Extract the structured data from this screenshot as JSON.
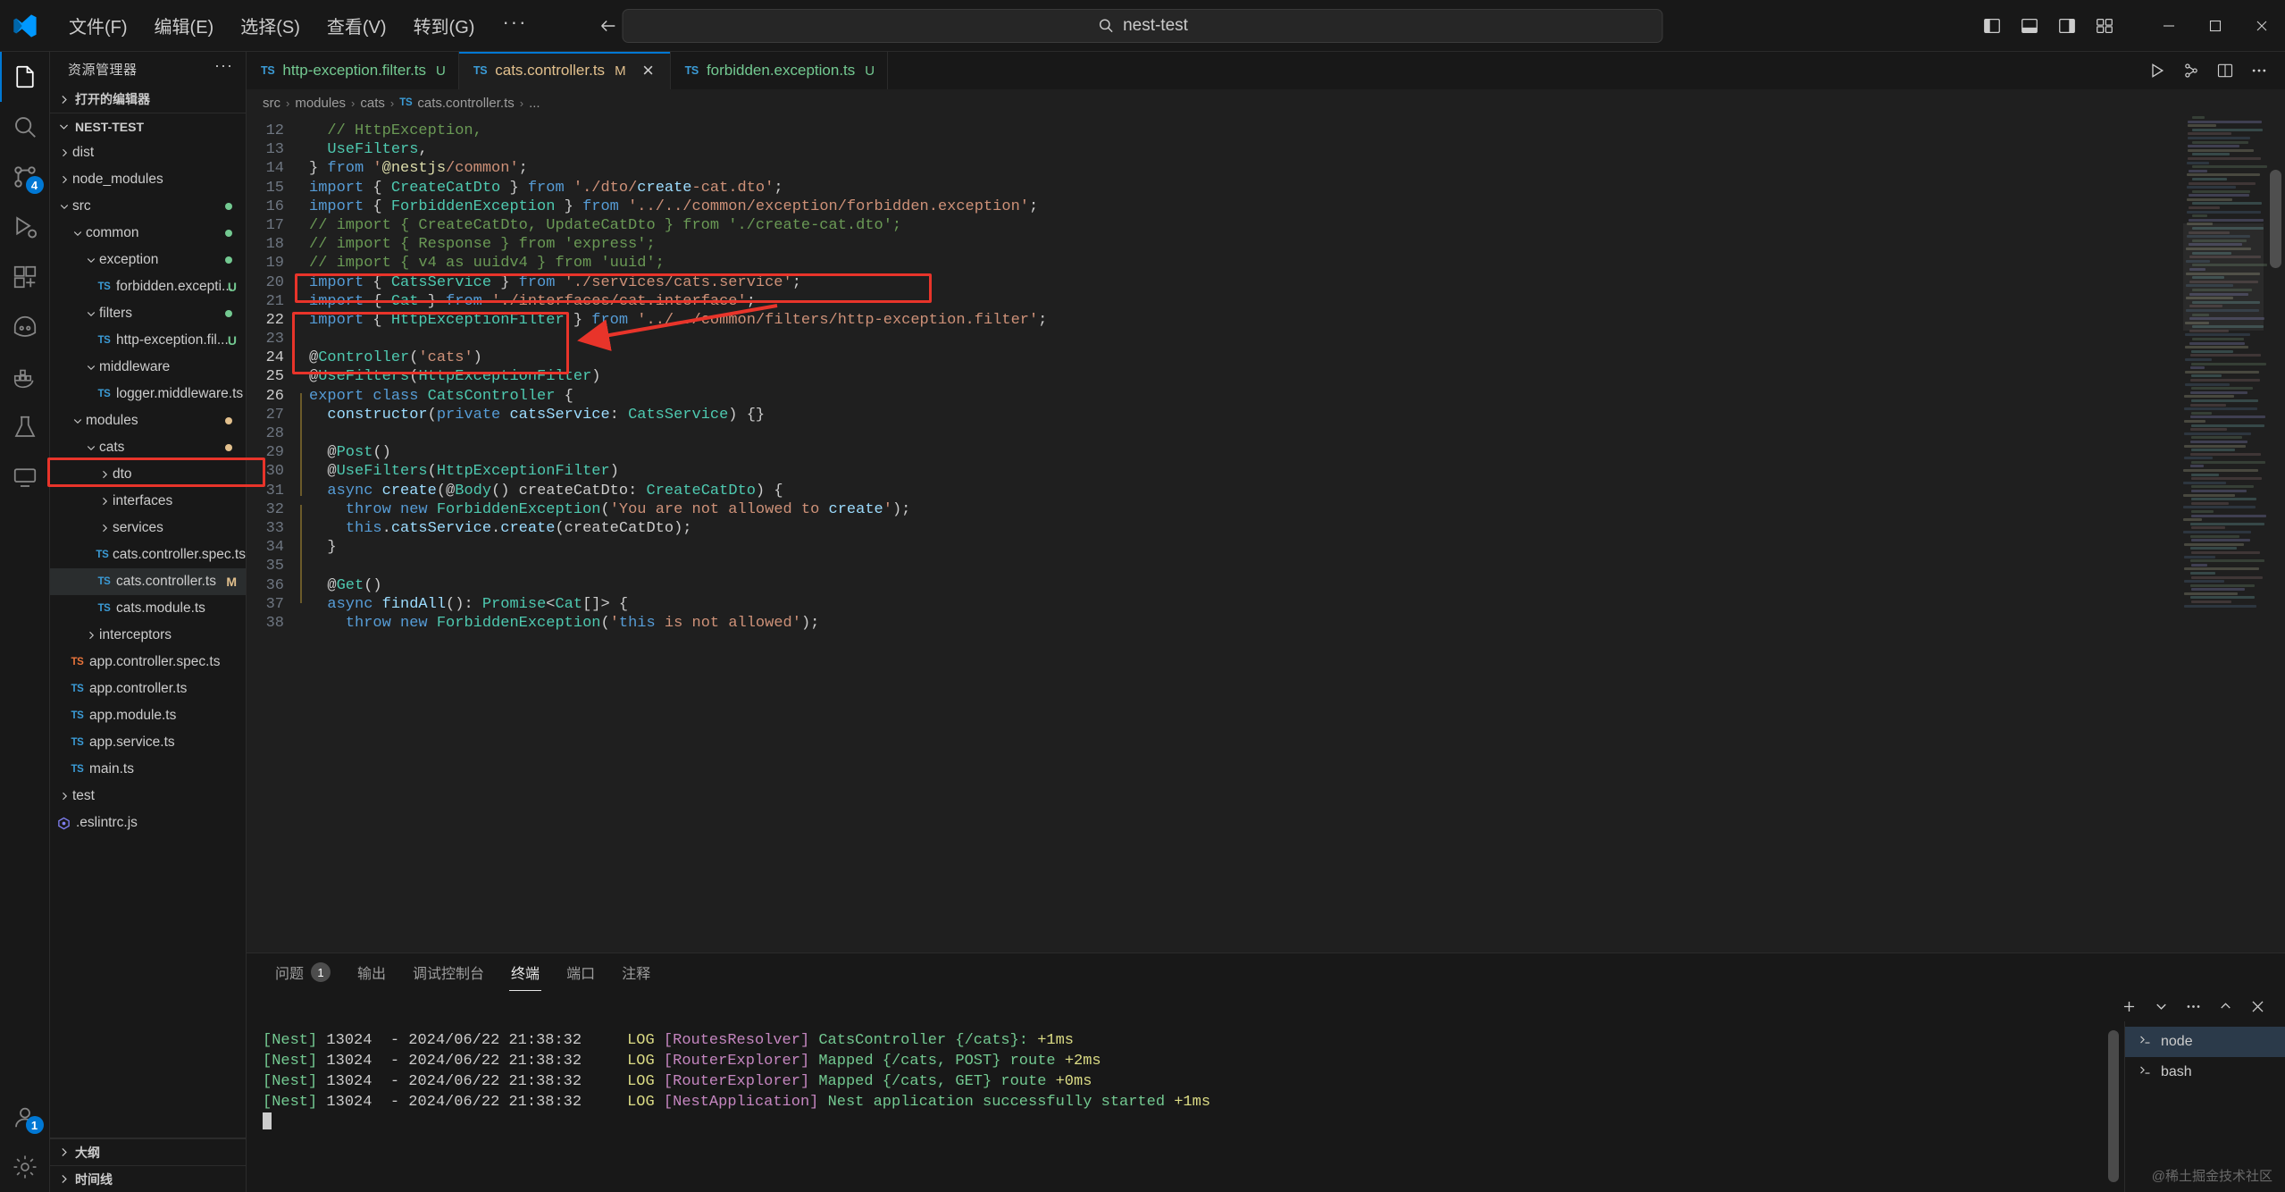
{
  "titlebar": {
    "menu": [
      "文件(F)",
      "编辑(E)",
      "选择(S)",
      "查看(V)",
      "转到(G)"
    ],
    "more": "···",
    "back_icon": "arrow-left-icon",
    "forward_icon": "arrow-right-icon",
    "search_text": "nest-test",
    "search_icon": "search-icon",
    "layout_icons": [
      "toggle-primary-sidebar-icon",
      "toggle-panel-icon",
      "toggle-secondary-sidebar-icon",
      "customize-layout-icon"
    ],
    "window_buttons": [
      "minimize",
      "maximize",
      "close"
    ]
  },
  "activitybar": {
    "items": [
      {
        "name": "explorer",
        "icon": "files-icon",
        "active": true,
        "badge": ""
      },
      {
        "name": "search",
        "icon": "search-icon",
        "active": false,
        "badge": ""
      },
      {
        "name": "source-control",
        "icon": "source-control-icon",
        "active": false,
        "badge": "4"
      },
      {
        "name": "run-debug",
        "icon": "debug-icon",
        "active": false,
        "badge": ""
      },
      {
        "name": "extensions",
        "icon": "extensions-icon",
        "active": false,
        "badge": ""
      },
      {
        "name": "copilot",
        "icon": "copilot-icon",
        "active": false,
        "badge": ""
      },
      {
        "name": "docker",
        "icon": "docker-icon",
        "active": false,
        "badge": ""
      },
      {
        "name": "testing",
        "icon": "beaker-icon",
        "active": false,
        "badge": ""
      },
      {
        "name": "remote-explorer",
        "icon": "remote-icon",
        "active": false,
        "badge": ""
      }
    ],
    "bottom": [
      {
        "name": "accounts",
        "icon": "account-icon",
        "badge": "1"
      },
      {
        "name": "settings",
        "icon": "gear-icon",
        "badge": ""
      }
    ]
  },
  "sidebar": {
    "title": "资源管理器",
    "dots": "···",
    "open_editors_label": "打开的编辑器",
    "project_name": "NEST-TEST",
    "outline_label": "大纲",
    "timeline_label": "时间线",
    "tree": [
      {
        "label": "dist",
        "depth": 1,
        "type": "folder",
        "open": false,
        "color": "dim",
        "badge": "",
        "dot": ""
      },
      {
        "label": "node_modules",
        "depth": 1,
        "type": "folder",
        "open": false,
        "color": "dim",
        "badge": "",
        "dot": ""
      },
      {
        "label": "src",
        "depth": 1,
        "type": "folder",
        "open": true,
        "color": "g",
        "badge": "",
        "dot": "#73c991"
      },
      {
        "label": "common",
        "depth": 2,
        "type": "folder",
        "open": true,
        "color": "g",
        "badge": "",
        "dot": "#73c991"
      },
      {
        "label": "exception",
        "depth": 3,
        "type": "folder",
        "open": true,
        "color": "g",
        "badge": "",
        "dot": "#73c991"
      },
      {
        "label": "forbidden.excepti...",
        "depth": 4,
        "type": "ts",
        "open": false,
        "color": "g",
        "badge": "U",
        "dot": ""
      },
      {
        "label": "filters",
        "depth": 3,
        "type": "folder",
        "open": true,
        "color": "g",
        "badge": "",
        "dot": "#73c991"
      },
      {
        "label": "http-exception.fil...",
        "depth": 4,
        "type": "ts",
        "open": false,
        "color": "g",
        "badge": "U",
        "dot": ""
      },
      {
        "label": "middleware",
        "depth": 3,
        "type": "folder",
        "open": true,
        "color": "",
        "badge": "",
        "dot": ""
      },
      {
        "label": "logger.middleware.ts",
        "depth": 4,
        "type": "ts",
        "open": false,
        "color": "",
        "badge": "",
        "dot": ""
      },
      {
        "label": "modules",
        "depth": 2,
        "type": "folder",
        "open": true,
        "color": "y",
        "badge": "",
        "dot": "#e2c08d"
      },
      {
        "label": "cats",
        "depth": 3,
        "type": "folder",
        "open": true,
        "color": "y",
        "badge": "",
        "dot": "#e2c08d"
      },
      {
        "label": "dto",
        "depth": 4,
        "type": "folder",
        "open": false,
        "color": "",
        "badge": "",
        "dot": ""
      },
      {
        "label": "interfaces",
        "depth": 4,
        "type": "folder",
        "open": false,
        "color": "",
        "badge": "",
        "dot": ""
      },
      {
        "label": "services",
        "depth": 4,
        "type": "folder",
        "open": false,
        "color": "",
        "badge": "",
        "dot": ""
      },
      {
        "label": "cats.controller.spec.ts",
        "depth": 4,
        "type": "ts",
        "open": false,
        "color": "",
        "badge": "",
        "dot": ""
      },
      {
        "label": "cats.controller.ts",
        "depth": 4,
        "type": "ts",
        "open": false,
        "color": "y",
        "badge": "M",
        "dot": "",
        "selected": true
      },
      {
        "label": "cats.module.ts",
        "depth": 4,
        "type": "ts",
        "open": false,
        "color": "",
        "badge": "",
        "dot": ""
      },
      {
        "label": "interceptors",
        "depth": 3,
        "type": "folder",
        "open": false,
        "color": "",
        "badge": "",
        "dot": ""
      },
      {
        "label": "app.controller.spec.ts",
        "depth": 2,
        "type": "ts-o",
        "open": false,
        "color": "",
        "badge": "",
        "dot": ""
      },
      {
        "label": "app.controller.ts",
        "depth": 2,
        "type": "ts",
        "open": false,
        "color": "",
        "badge": "",
        "dot": ""
      },
      {
        "label": "app.module.ts",
        "depth": 2,
        "type": "ts",
        "open": false,
        "color": "",
        "badge": "",
        "dot": ""
      },
      {
        "label": "app.service.ts",
        "depth": 2,
        "type": "ts",
        "open": false,
        "color": "",
        "badge": "",
        "dot": ""
      },
      {
        "label": "main.ts",
        "depth": 2,
        "type": "ts",
        "open": false,
        "color": "",
        "badge": "",
        "dot": ""
      },
      {
        "label": "test",
        "depth": 1,
        "type": "folder",
        "open": false,
        "color": "",
        "badge": "",
        "dot": ""
      },
      {
        "label": ".eslintrc.js",
        "depth": 1,
        "type": "eslint",
        "open": false,
        "color": "",
        "badge": "",
        "dot": ""
      }
    ]
  },
  "tabs": [
    {
      "name": "http-exception.filter.ts",
      "mark": "U",
      "mark_color": "#73c991",
      "name_color": "#73c991",
      "active": false,
      "closable": false
    },
    {
      "name": "cats.controller.ts",
      "mark": "M",
      "mark_color": "#e2c08d",
      "name_color": "#e2c08d",
      "active": true,
      "closable": true
    },
    {
      "name": "forbidden.exception.ts",
      "mark": "U",
      "mark_color": "#73c991",
      "name_color": "#73c991",
      "active": false,
      "closable": false
    }
  ],
  "tabs_actions": [
    "run-icon",
    "split-run-icon",
    "split-editor-icon",
    "more-actions-icon"
  ],
  "breadcrumb": [
    "src",
    "modules",
    "cats",
    "cats.controller.ts",
    "..."
  ],
  "editor": {
    "first_line": 12,
    "lines": [
      {
        "n": 12,
        "text": "  // HttpException,"
      },
      {
        "n": 13,
        "text": "  UseFilters,"
      },
      {
        "n": 14,
        "text": "} from '@nestjs/common';"
      },
      {
        "n": 15,
        "text": "import { CreateCatDto } from './dto/create-cat.dto';"
      },
      {
        "n": 16,
        "text": "import { ForbiddenException } from '../../common/exception/forbidden.exception';"
      },
      {
        "n": 17,
        "text": "// import { CreateCatDto, UpdateCatDto } from './create-cat.dto';"
      },
      {
        "n": 18,
        "text": "// import { Response } from 'express';"
      },
      {
        "n": 19,
        "text": "// import { v4 as uuidv4 } from 'uuid';"
      },
      {
        "n": 20,
        "text": "import { CatsService } from './services/cats.service';"
      },
      {
        "n": 21,
        "text": "import { Cat } from './interfaces/cat.interface';"
      },
      {
        "n": 22,
        "text": "import { HttpExceptionFilter } from '../../common/filters/http-exception.filter';"
      },
      {
        "n": 23,
        "text": ""
      },
      {
        "n": 24,
        "text": "@Controller('cats')"
      },
      {
        "n": 25,
        "text": "@UseFilters(HttpExceptionFilter)"
      },
      {
        "n": 26,
        "text": "export class CatsController {"
      },
      {
        "n": 27,
        "text": "  constructor(private catsService: CatsService) {}"
      },
      {
        "n": 28,
        "text": ""
      },
      {
        "n": 29,
        "text": "  @Post()"
      },
      {
        "n": 30,
        "text": "  @UseFilters(HttpExceptionFilter)"
      },
      {
        "n": 31,
        "text": "  async create(@Body() createCatDto: CreateCatDto) {"
      },
      {
        "n": 32,
        "text": "    throw new ForbiddenException('You are not allowed to create');"
      },
      {
        "n": 33,
        "text": "    this.catsService.create(createCatDto);"
      },
      {
        "n": 34,
        "text": "  }"
      },
      {
        "n": 35,
        "text": ""
      },
      {
        "n": 36,
        "text": "  @Get()"
      },
      {
        "n": 37,
        "text": "  async findAll(): Promise<Cat[]> {"
      },
      {
        "n": 38,
        "text": "    throw new ForbiddenException('this is not allowed');"
      }
    ]
  },
  "panel": {
    "tabs": [
      {
        "label": "问题",
        "badge": "1",
        "active": false
      },
      {
        "label": "输出",
        "badge": "",
        "active": false
      },
      {
        "label": "调试控制台",
        "badge": "",
        "active": false
      },
      {
        "label": "终端",
        "badge": "",
        "active": true
      },
      {
        "label": "端口",
        "badge": "",
        "active": false
      },
      {
        "label": "注释",
        "badge": "",
        "active": false
      }
    ],
    "actions": [
      "new-terminal-icon",
      "terminal-dropdown-icon",
      "more-actions-icon",
      "maximize-panel-icon",
      "close-panel-icon"
    ],
    "terminal_lines": [
      {
        "nest": "[Nest]",
        "pid": "13024",
        "dash": "-",
        "date": "2024/06/22 21:38:32",
        "level": "LOG",
        "ctx": "[RoutesResolver]",
        "msg": "CatsController {/cats}:",
        "ms": "+1ms"
      },
      {
        "nest": "[Nest]",
        "pid": "13024",
        "dash": "-",
        "date": "2024/06/22 21:38:32",
        "level": "LOG",
        "ctx": "[RouterExplorer]",
        "msg": "Mapped {/cats, POST} route",
        "ms": "+2ms"
      },
      {
        "nest": "[Nest]",
        "pid": "13024",
        "dash": "-",
        "date": "2024/06/22 21:38:32",
        "level": "LOG",
        "ctx": "[RouterExplorer]",
        "msg": "Mapped {/cats, GET} route",
        "ms": "+0ms"
      },
      {
        "nest": "[Nest]",
        "pid": "13024",
        "dash": "-",
        "date": "2024/06/22 21:38:32",
        "level": "LOG",
        "ctx": "[NestApplication]",
        "msg": "Nest application successfully started",
        "ms": "+1ms"
      }
    ],
    "terminal_list": [
      {
        "label": "node",
        "icon": "terminal-icon",
        "active": true
      },
      {
        "label": "bash",
        "icon": "terminal-icon",
        "active": false
      }
    ]
  },
  "watermark": "@稀土掘金技术社区",
  "colors": {
    "accent": "#0078d4",
    "annotation_red": "#e8342a",
    "green": "#73c991",
    "yellow": "#e2c08d"
  }
}
